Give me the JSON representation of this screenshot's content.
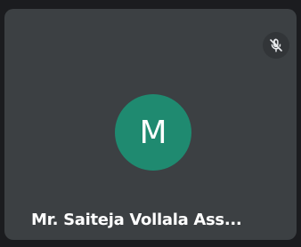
{
  "participant": {
    "avatar_initial": "M",
    "display_name": "Mr. Saiteja Vollala Ass...",
    "mic_status_icon": "mic-off-icon"
  },
  "colors": {
    "tile_background": "#3c4043",
    "avatar_background": "#1f8a70",
    "page_background": "#1b1c1f",
    "text": "#ffffff"
  }
}
